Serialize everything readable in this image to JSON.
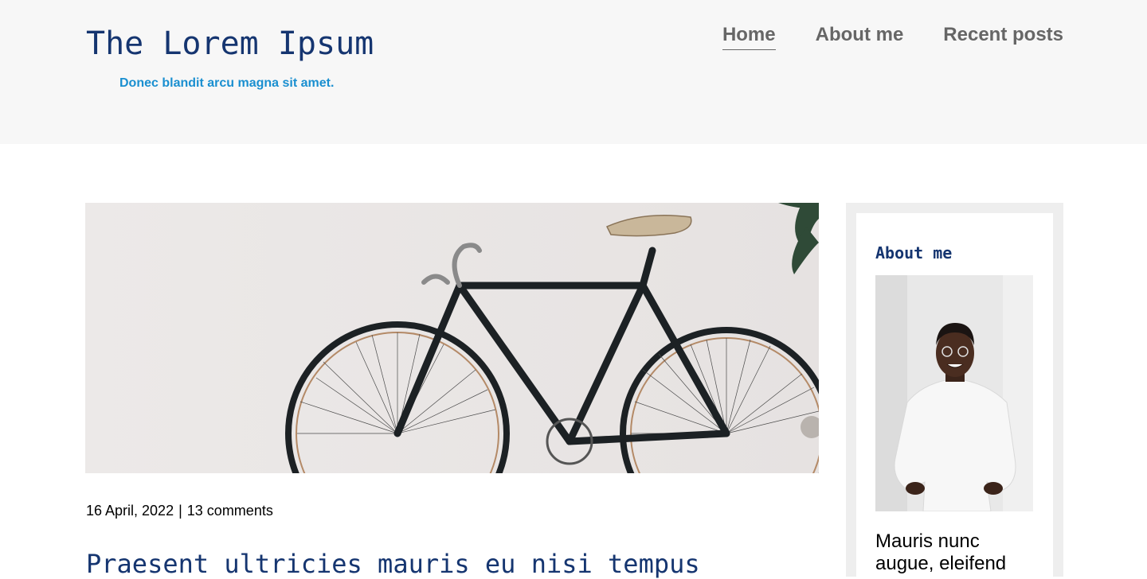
{
  "header": {
    "site_title": "The Lorem Ipsum",
    "tagline": "Donec blandit arcu magna sit amet."
  },
  "nav": {
    "items": [
      {
        "label": "Home",
        "active": true
      },
      {
        "label": "About me",
        "active": false
      },
      {
        "label": "Recent posts",
        "active": false
      }
    ]
  },
  "post": {
    "date": "16 April, 2022",
    "separator": "|",
    "comments": "13 comments",
    "title": "Praesent ultricies mauris eu nisi tempus"
  },
  "sidebar": {
    "about_title": "About me",
    "about_text": "Mauris nunc augue, eleifend"
  },
  "colors": {
    "title_blue": "#153570",
    "tagline_blue": "#1a8fd0",
    "nav_gray": "#666666",
    "header_bg": "#f7f7f7",
    "sidebar_bg": "#eeeeee"
  }
}
